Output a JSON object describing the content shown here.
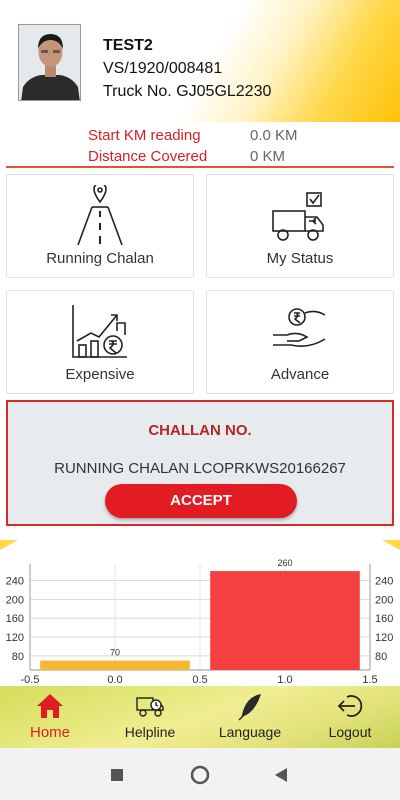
{
  "profile": {
    "name": "TEST2",
    "id": "VS/1920/008481",
    "truck": "Truck No. GJ05GL2230"
  },
  "km": {
    "start_label": "Start KM reading",
    "start_value": "0.0 KM",
    "distance_label": "Distance Covered",
    "distance_value": "0 KM"
  },
  "tiles": [
    {
      "label": "Running Chalan",
      "icon": "road-location-icon"
    },
    {
      "label": "My Status",
      "icon": "truck-check-icon"
    },
    {
      "label": "Expensive",
      "icon": "growth-chart-rupee-icon"
    },
    {
      "label": "Advance",
      "icon": "hand-rupee-coin-icon"
    }
  ],
  "challan": {
    "title": "CHALLAN NO.",
    "running": "RUNNING CHALAN LCOPRKWS20166267",
    "accept_label": "ACCEPT"
  },
  "chart_data": {
    "type": "bar",
    "x": [
      0.0,
      1.0
    ],
    "values": [
      70,
      260
    ],
    "bar_colors": [
      "#f7b733",
      "#f44040"
    ],
    "data_labels": [
      "70",
      "260"
    ],
    "x_ticks": [
      "-0.5",
      "0.0",
      "0.5",
      "1.0",
      "1.5"
    ],
    "y_ticks": [
      "80",
      "120",
      "160",
      "200",
      "240"
    ],
    "xlim": [
      -0.5,
      1.5
    ],
    "ylim": [
      50,
      275
    ],
    "grid": true,
    "dual_y_axis": true
  },
  "nav": [
    {
      "label": "Home",
      "icon": "home-icon",
      "active": true
    },
    {
      "label": "Helpline",
      "icon": "helpline-truck-icon",
      "active": false
    },
    {
      "label": "Language",
      "icon": "feather-pen-icon",
      "active": false
    },
    {
      "label": "Logout",
      "icon": "logout-icon",
      "active": false
    }
  ],
  "colors": {
    "accent_red": "#e31b23",
    "header_yellow": "#ffc107",
    "nav_green_yellow": "#e4e87a"
  }
}
